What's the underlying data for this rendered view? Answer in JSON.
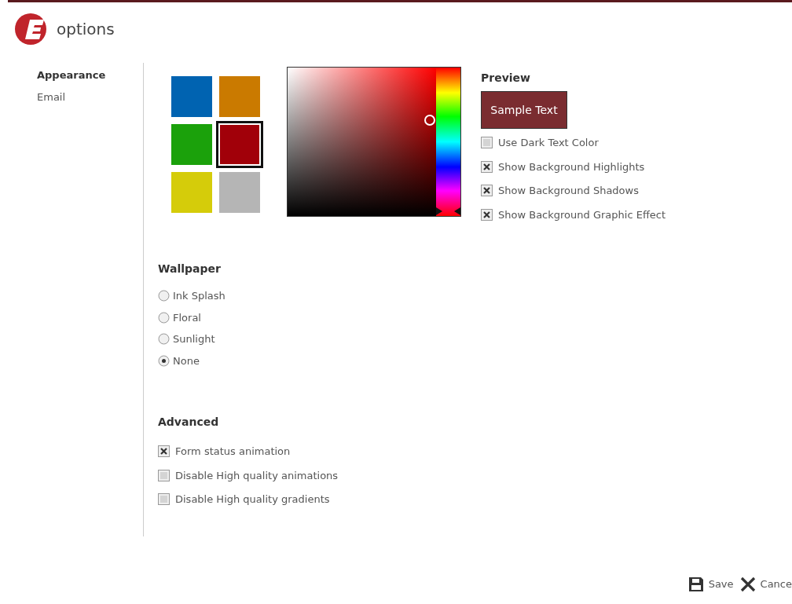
{
  "window": {
    "title": "options"
  },
  "sidebar": {
    "items": [
      {
        "label": "Appearance",
        "selected": true
      },
      {
        "label": "Email",
        "selected": false
      }
    ]
  },
  "swatches": [
    {
      "color": "#0063b1",
      "selected": false
    },
    {
      "color": "#ca7a00",
      "selected": false
    },
    {
      "color": "#1ba10b",
      "selected": false
    },
    {
      "color": "#a10009",
      "selected": true
    },
    {
      "color": "#d5cc0a",
      "selected": false
    },
    {
      "color": "#b5b5b5",
      "selected": false
    }
  ],
  "preview": {
    "heading": "Preview",
    "sample": "Sample Text",
    "options": [
      {
        "label": "Use Dark Text Color",
        "checked": false
      },
      {
        "label": "Show Background Highlights",
        "checked": true
      },
      {
        "label": "Show Background Shadows",
        "checked": true
      },
      {
        "label": "Show Background Graphic Effect",
        "checked": true
      }
    ]
  },
  "wallpaper": {
    "heading": "Wallpaper",
    "options": [
      {
        "label": "Ink Splash",
        "selected": false
      },
      {
        "label": "Floral",
        "selected": false
      },
      {
        "label": "Sunlight",
        "selected": false
      },
      {
        "label": "None",
        "selected": true
      }
    ]
  },
  "advanced": {
    "heading": "Advanced",
    "options": [
      {
        "label": "Form status animation",
        "checked": true
      },
      {
        "label": "Disable High quality animations",
        "checked": false
      },
      {
        "label": "Disable High quality gradients",
        "checked": false
      }
    ]
  },
  "buttons": [
    {
      "kind": "save",
      "label": "Save"
    },
    {
      "kind": "cancel",
      "label": "Cance"
    }
  ]
}
